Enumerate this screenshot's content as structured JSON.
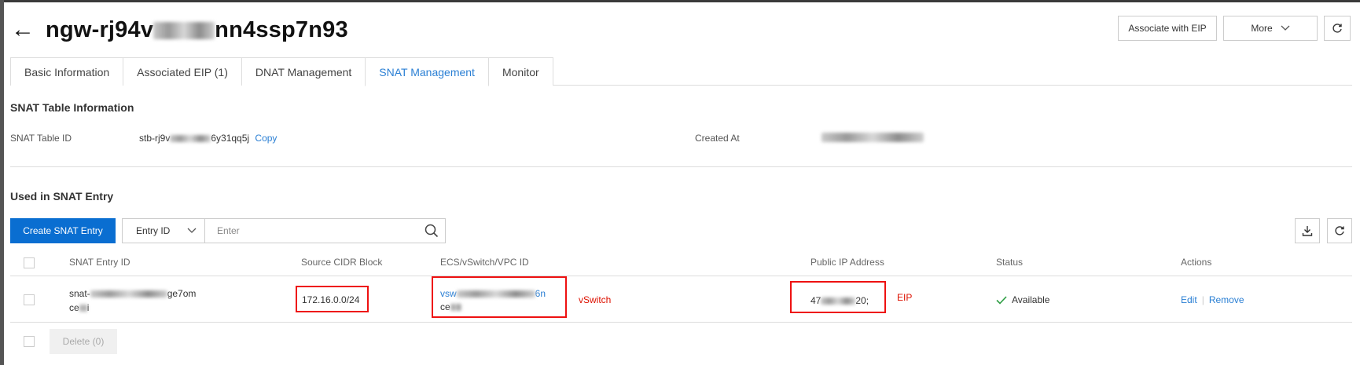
{
  "header": {
    "back_icon": "arrow-left-icon",
    "title_prefix": "ngw-rj94v",
    "title_suffix": "nn4ssp7n93",
    "associate_eip": "Associate with EIP",
    "more": "More",
    "refresh_icon": "refresh-icon"
  },
  "tabs": [
    {
      "label": "Basic Information"
    },
    {
      "label": "Associated EIP (1)"
    },
    {
      "label": "DNAT Management"
    },
    {
      "label": "SNAT Management"
    },
    {
      "label": "Monitor"
    }
  ],
  "snat_info": {
    "title": "SNAT Table Information",
    "table_id_label": "SNAT Table ID",
    "table_id_prefix": "stb-rj9v",
    "table_id_suffix": "6y31qq5j",
    "copy": "Copy",
    "created_label": "Created At"
  },
  "entries": {
    "title": "Used in SNAT Entry",
    "create_button": "Create SNAT Entry",
    "filter_select": "Entry ID",
    "search_placeholder": "Enter",
    "columns": [
      "SNAT Entry ID",
      "Source CIDR Block",
      "ECS/vSwitch/VPC ID",
      "Public IP Address",
      "Status",
      "Actions"
    ],
    "rows": [
      {
        "entry_id_prefix": "snat-",
        "entry_id_suffix": "ge7om",
        "entry_name_prefix": "ce",
        "entry_name_suffix": "i",
        "cidr": "172.16.0.0/24",
        "vswitch_prefix": "vsw",
        "vswitch_suffix": "6n",
        "vswitch_name_prefix": "ce",
        "public_ip_prefix": "47",
        "public_ip_suffix": "20;",
        "status": "Available",
        "edit": "Edit",
        "remove": "Remove"
      }
    ],
    "delete_button": "Delete (0)"
  },
  "annotations": {
    "vswitch": "vSwitch",
    "eip": "EIP"
  },
  "colors": {
    "accent": "#0a6ed1",
    "link": "#2a7fd4",
    "highlight": "#e11111",
    "success": "#2e9e44"
  }
}
